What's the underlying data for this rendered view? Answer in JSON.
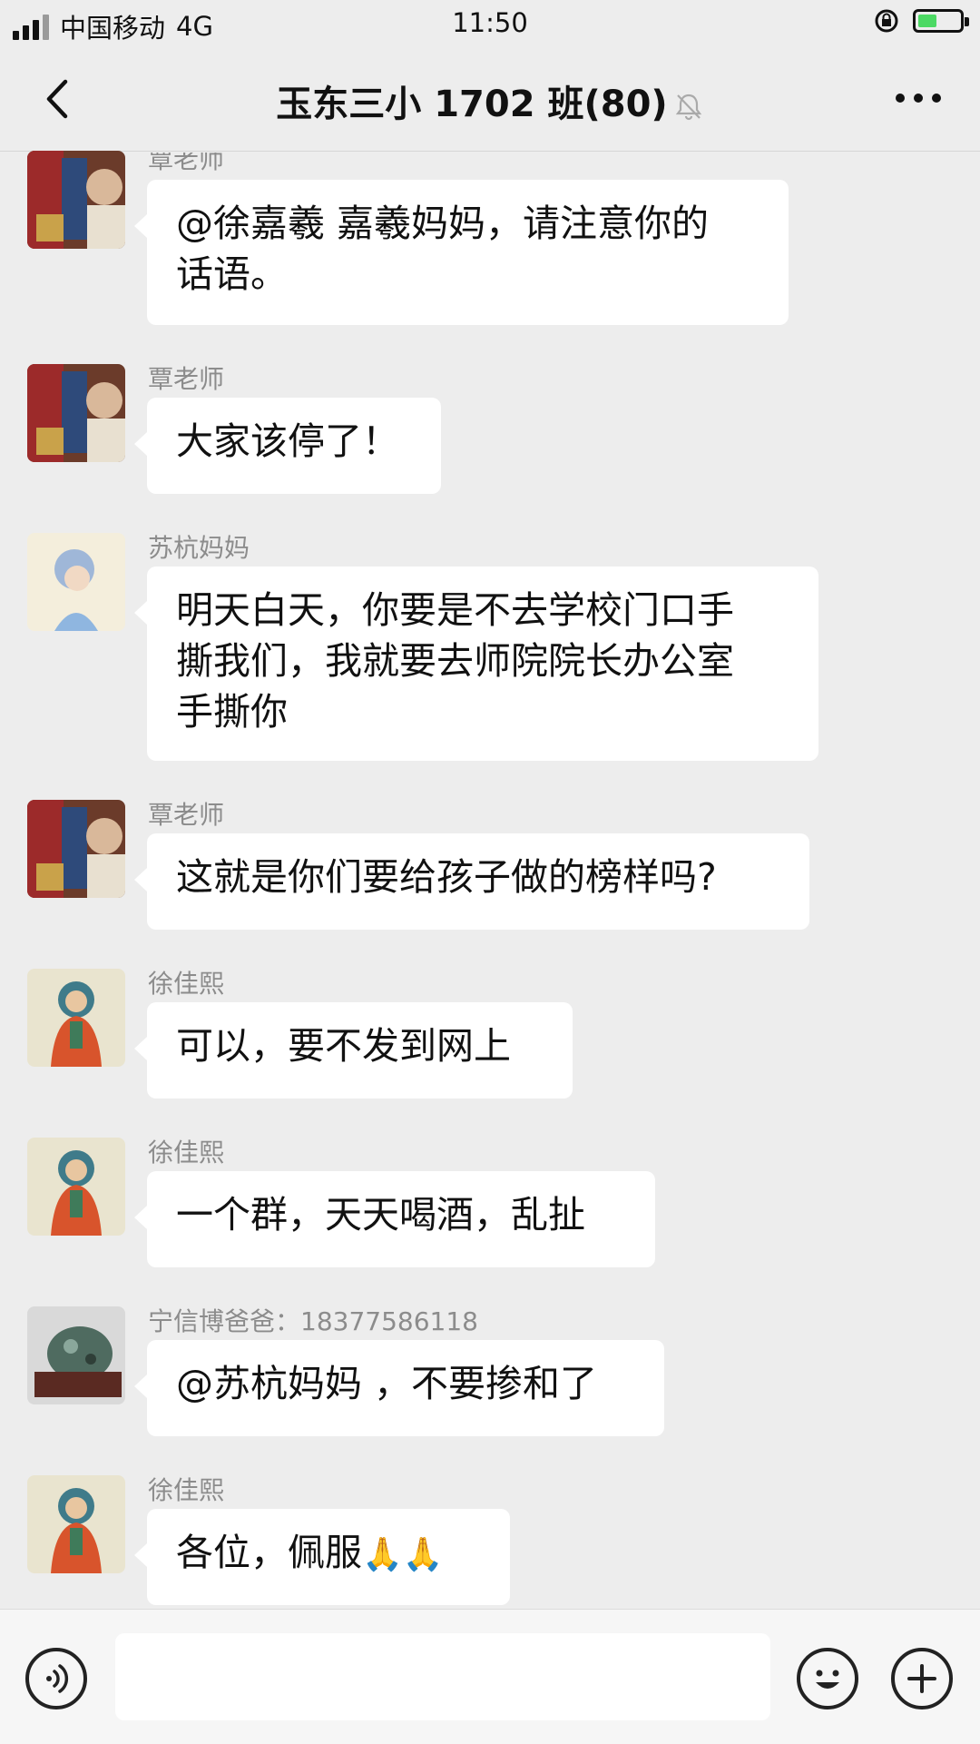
{
  "status_bar": {
    "carrier": "中国移动",
    "network": "4G",
    "time": "11:50"
  },
  "nav": {
    "title": "玉东三小 1702 班(80)",
    "muted_icon": "bell-slash-icon",
    "back_icon": "chevron-left-icon",
    "more_icon": "more-horizontal-icon"
  },
  "messages": [
    {
      "sender": "覃老师",
      "avatar": "painting-avatar",
      "lines": [
        "@徐嘉羲 嘉羲妈妈，请注意你的",
        "话语。"
      ]
    },
    {
      "sender": "覃老师",
      "avatar": "painting-avatar",
      "lines": [
        "大家该停了！"
      ]
    },
    {
      "sender": "苏杭妈妈",
      "avatar": "portrait-avatar",
      "lines": [
        "明天白天，你要是不去学校门口手",
        "撕我们，我就要去师院院长办公室",
        "手撕你"
      ]
    },
    {
      "sender": "覃老师",
      "avatar": "painting-avatar",
      "lines": [
        "这就是你们要给孩子做的榜样吗?"
      ]
    },
    {
      "sender": "徐佳熙",
      "avatar": "buddha-avatar",
      "lines": [
        "可以，要不发到网上"
      ]
    },
    {
      "sender": "徐佳熙",
      "avatar": "buddha-avatar",
      "lines": [
        "一个群，天天喝酒，乱扯"
      ]
    },
    {
      "sender": "宁信博爸爸：18377586118",
      "avatar": "stone-avatar",
      "lines": [
        "@苏杭妈妈 ，不要掺和了"
      ]
    },
    {
      "sender": "徐佳熙",
      "avatar": "buddha-avatar",
      "lines": [
        "各位，佩服"
      ],
      "emoji": "🙏🙏"
    }
  ],
  "input_bar": {
    "voice_icon": "voice-icon",
    "emoji_icon": "smiley-icon",
    "plus_icon": "plus-icon",
    "text_value": ""
  },
  "colors": {
    "background": "#ededed",
    "bubble": "#ffffff",
    "sender_name": "#8c8c8c"
  }
}
